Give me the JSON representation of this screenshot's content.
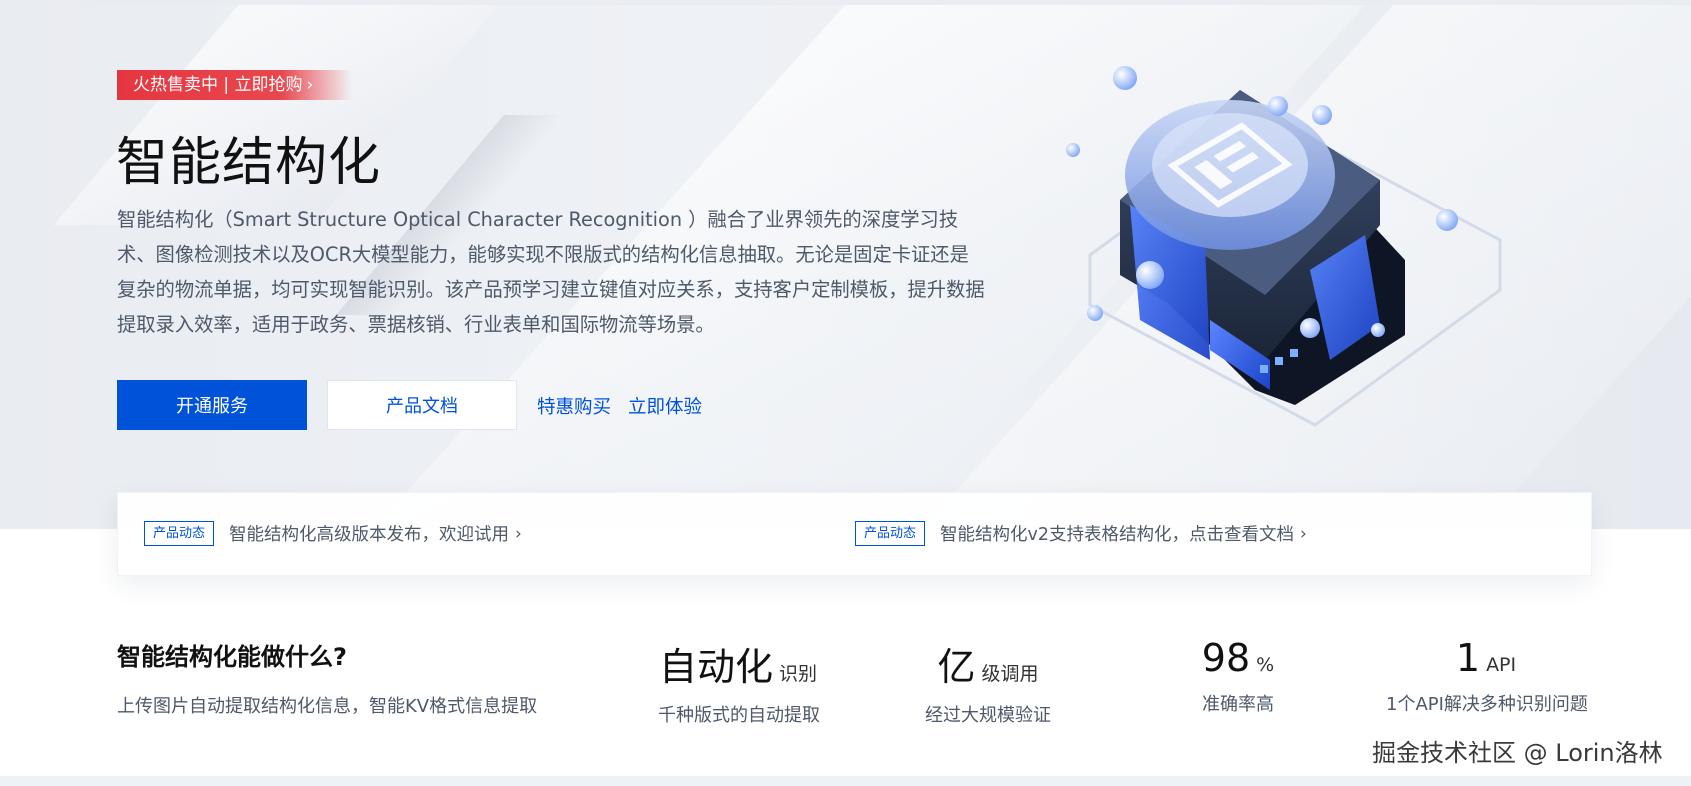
{
  "hero": {
    "promo_badge": "火热售卖中 | 立即抢购",
    "title": "智能结构化",
    "description": "智能结构化（Smart Structure Optical Character Recognition ）融合了业界领先的深度学习技术、图像检测技术以及OCR大模型能力，能够实现不限版式的结构化信息抽取。无论是固定卡证还是复杂的物流单据，均可实现智能识别。该产品预学习建立键值对应关系，支持客户定制模板，提升数据提取录入效率，适用于政务、票据核销、行业表单和国际物流等场景。",
    "buttons": {
      "primary": "开通服务",
      "secondary": "产品文档"
    },
    "links": [
      "特惠购买",
      "立即体验"
    ]
  },
  "news": [
    {
      "tag": "产品动态",
      "text": "智能结构化高级版本发布，欢迎试用"
    },
    {
      "tag": "产品动态",
      "text": "智能结构化v2支持表格结构化，点击查看文档"
    }
  ],
  "capability": {
    "title": "智能结构化能做什么?",
    "subtitle": "上传图片自动提取结构化信息，智能KV格式信息提取"
  },
  "stats": [
    {
      "value": "自动化",
      "unit": "识别",
      "desc": "千种版式的自动提取"
    },
    {
      "value": "亿",
      "unit": "级调用",
      "desc": "经过大规模验证"
    },
    {
      "value": "98",
      "unit": "%",
      "desc": "准确率高"
    },
    {
      "value": "1",
      "unit": "API",
      "desc": "1个API解决多种识别问题"
    }
  ],
  "watermark": "掘金技术社区 @ Lorin洛林",
  "colors": {
    "primary": "#0052d9",
    "promo": "#e5363f",
    "text": "#4e5969"
  }
}
